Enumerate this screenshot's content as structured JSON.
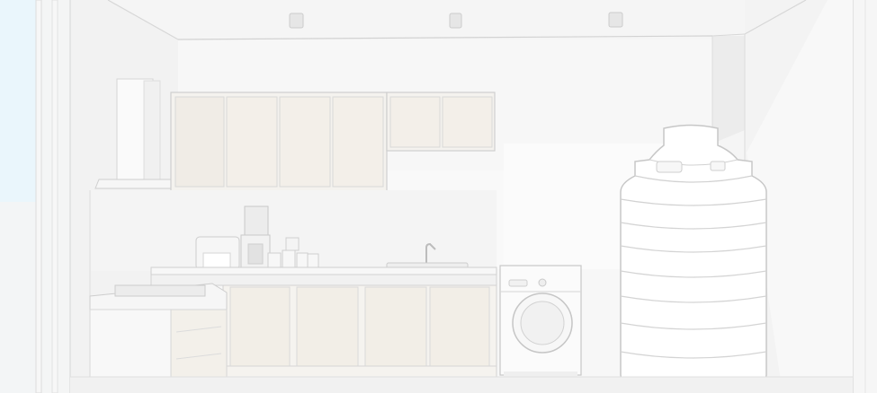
{
  "scene": {
    "palette": {
      "window_sky": "#eaf6fc",
      "wall": "#f5f5f5",
      "wall_shadow": "#eeeeee",
      "line": "#d9d9d9",
      "line_dark": "#c9c9c9",
      "cabinet_panel": "#f3efe9",
      "appliance_white": "#fbfbfb",
      "tank_white": "#ffffff"
    },
    "icons": [
      "ceiling-light-icon",
      "range-hood-icon",
      "coffee-maker-icon",
      "toaster-icon",
      "faucet-icon",
      "washing-machine-icon",
      "water-tank-icon"
    ]
  }
}
